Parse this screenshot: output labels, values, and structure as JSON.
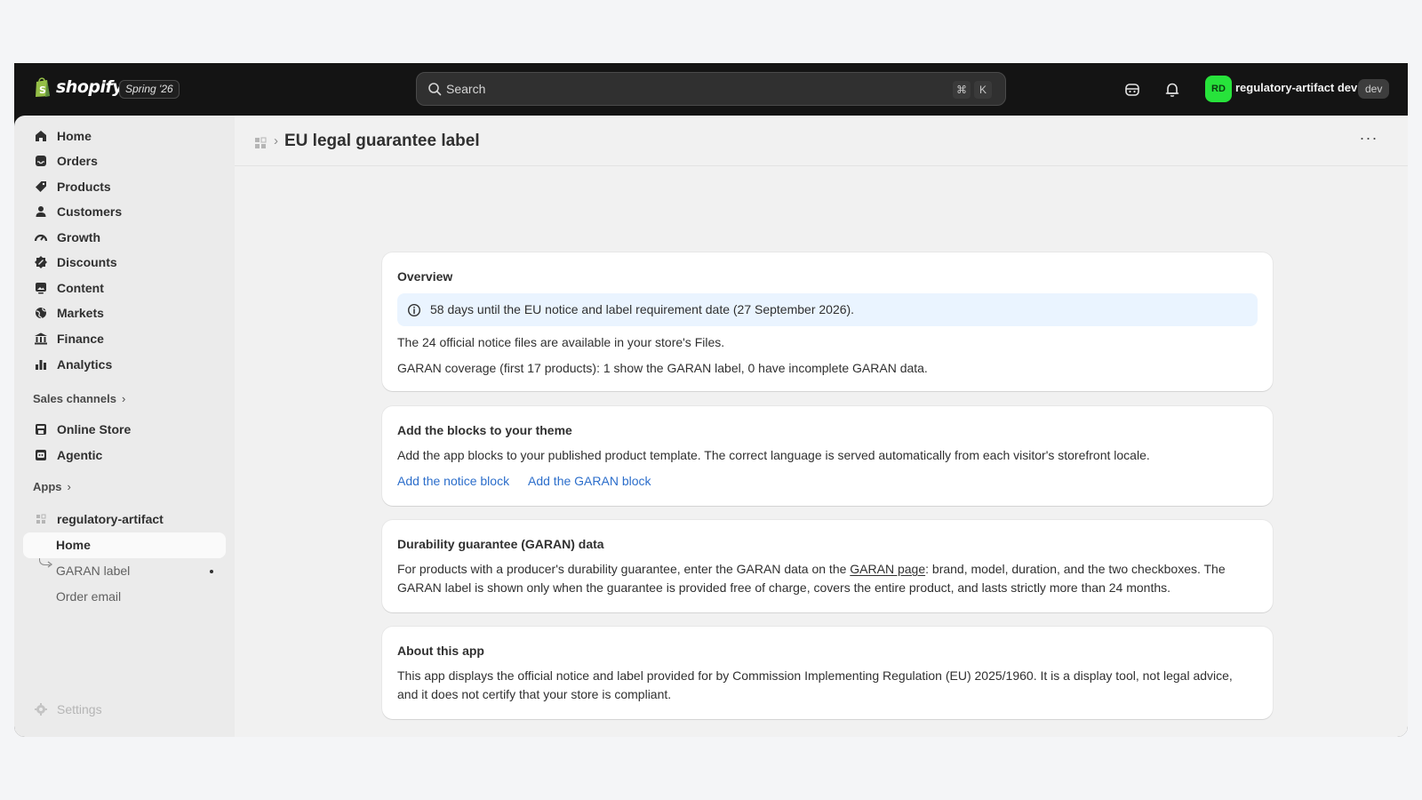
{
  "topbar": {
    "brand": "shopify",
    "edition": "Spring '26",
    "search_placeholder": "Search",
    "shortcut_cmd": "⌘",
    "shortcut_key": "K",
    "avatar_initials": "RD",
    "store_name": "regulatory-artifact dev",
    "store_badge": "dev"
  },
  "sidebar": {
    "items": [
      {
        "label": "Home",
        "icon": "home-icon"
      },
      {
        "label": "Orders",
        "icon": "inbox-icon"
      },
      {
        "label": "Products",
        "icon": "tag-icon"
      },
      {
        "label": "Customers",
        "icon": "person-icon"
      },
      {
        "label": "Growth",
        "icon": "gauge-icon"
      },
      {
        "label": "Discounts",
        "icon": "discount-icon"
      },
      {
        "label": "Content",
        "icon": "image-icon"
      },
      {
        "label": "Markets",
        "icon": "globe-icon"
      },
      {
        "label": "Finance",
        "icon": "bank-icon"
      },
      {
        "label": "Analytics",
        "icon": "bar-chart-icon"
      }
    ],
    "sales_channels_label": "Sales channels",
    "channels": [
      {
        "label": "Online Store",
        "icon": "store-icon"
      },
      {
        "label": "Agentic",
        "icon": "robot-icon"
      }
    ],
    "apps_label": "Apps",
    "app": {
      "label": "regulatory-artifact",
      "subitems": [
        "Home",
        "GARAN label",
        "Order email"
      ]
    },
    "settings_label": "Settings"
  },
  "page": {
    "title": "EU legal guarantee label",
    "more_label": "···"
  },
  "cards": {
    "overview": {
      "title": "Overview",
      "banner": "58 days until the EU notice and label requirement date (27 September 2026).",
      "line1": "The 24 official notice files are available in your store's Files.",
      "line2": "GARAN coverage (first 17 products): 1 show the GARAN label, 0 have incomplete GARAN data."
    },
    "blocks": {
      "title": "Add the blocks to your theme",
      "text": "Add the app blocks to your published product template. The correct language is served automatically from each visitor's storefront locale.",
      "link1": "Add the notice block",
      "link2": "Add the GARAN block"
    },
    "garan": {
      "title": "Durability guarantee (GARAN) data",
      "text_before": "For products with a producer's durability guarantee, enter the GARAN data on the ",
      "link": "GARAN page",
      "text_after": ": brand, model, duration, and the two checkboxes. The GARAN label is shown only when the guarantee is provided free of charge, covers the entire product, and lasts strictly more than 24 months."
    },
    "about": {
      "title": "About this app",
      "text": "This app displays the official notice and label provided for by Commission Implementing Regulation (EU) 2025/1960. It is a display tool, not legal advice, and it does not certify that your store is compliant."
    }
  },
  "colors": {
    "topbar_bg": "#141414",
    "sidebar_bg": "#ebebeb",
    "main_bg": "#f1f1f1",
    "link": "#2c6ecb",
    "banner_bg": "#eaf4ff",
    "avatar_bg": "#27e33b"
  }
}
